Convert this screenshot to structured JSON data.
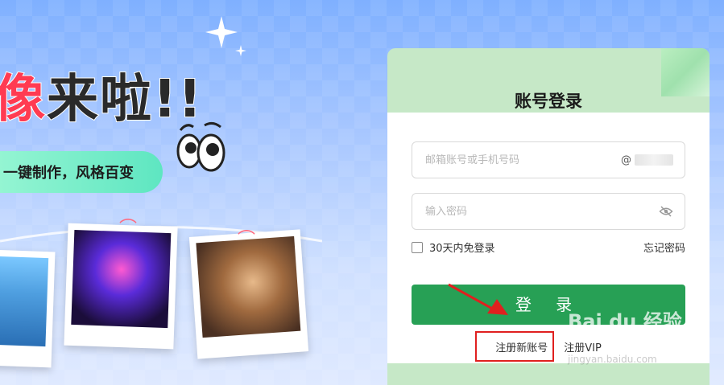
{
  "banner": {
    "headline_red": "像",
    "headline_dark": "来啦!!",
    "pill_text": "一键制作，风格百变"
  },
  "login_card": {
    "title": "账号登录",
    "email_placeholder": "邮箱账号或手机号码",
    "email_suffix": "@",
    "password_placeholder": "输入密码",
    "remember_label": "30天内免登录",
    "forgot_label": "忘记密码",
    "login_button": "登 录",
    "register_link": "注册新账号",
    "register_vip_link": "注册VIP"
  },
  "watermark": {
    "brand": "Bai du 经验",
    "url": "jingyan.baidu.com"
  },
  "colors": {
    "accent_green": "#27a055",
    "card_bg": "#c6e8c7",
    "highlight_red": "#e0201f"
  }
}
